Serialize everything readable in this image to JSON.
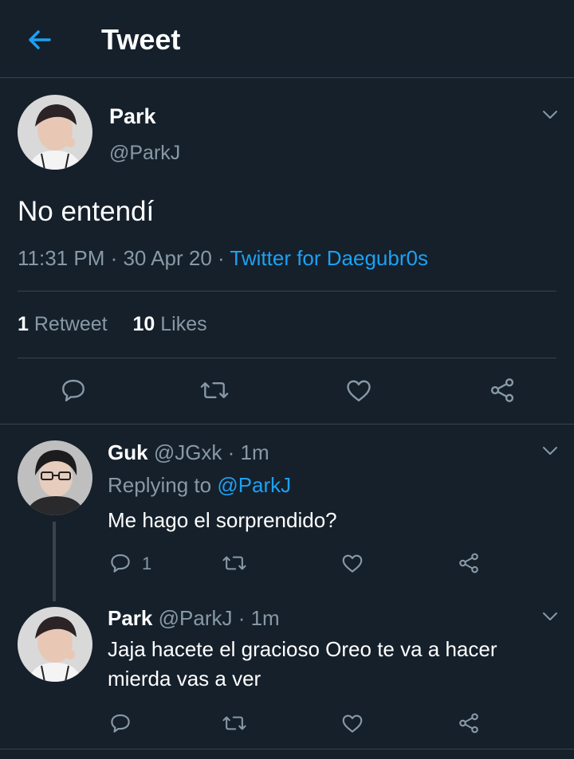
{
  "header": {
    "title": "Tweet"
  },
  "main_tweet": {
    "name": "Park",
    "handle": "@ParkJ",
    "text": "No entendí",
    "time": "11:31 PM · 30 Apr 20 · ",
    "source": "Twitter for Daegubr0s",
    "retweets_count": "1",
    "retweets_label": "Retweet",
    "likes_count": "10",
    "likes_label": "Likes"
  },
  "replies": [
    {
      "name": "Guk",
      "handle_time": "@JGxk · 1m",
      "replying_prefix": "Replying to ",
      "replying_to": "@ParkJ",
      "text": "Me hago el sorprendido?",
      "reply_count": "1"
    },
    {
      "name": "Park",
      "handle_time": "@ParkJ · 1m",
      "text": "Jaja hacete el gracioso Oreo te va a hacer mierda vas a ver"
    }
  ],
  "colors": {
    "background": "#15202b",
    "accent": "#1da1f2",
    "muted": "#8899a6",
    "divider": "#38444d"
  }
}
